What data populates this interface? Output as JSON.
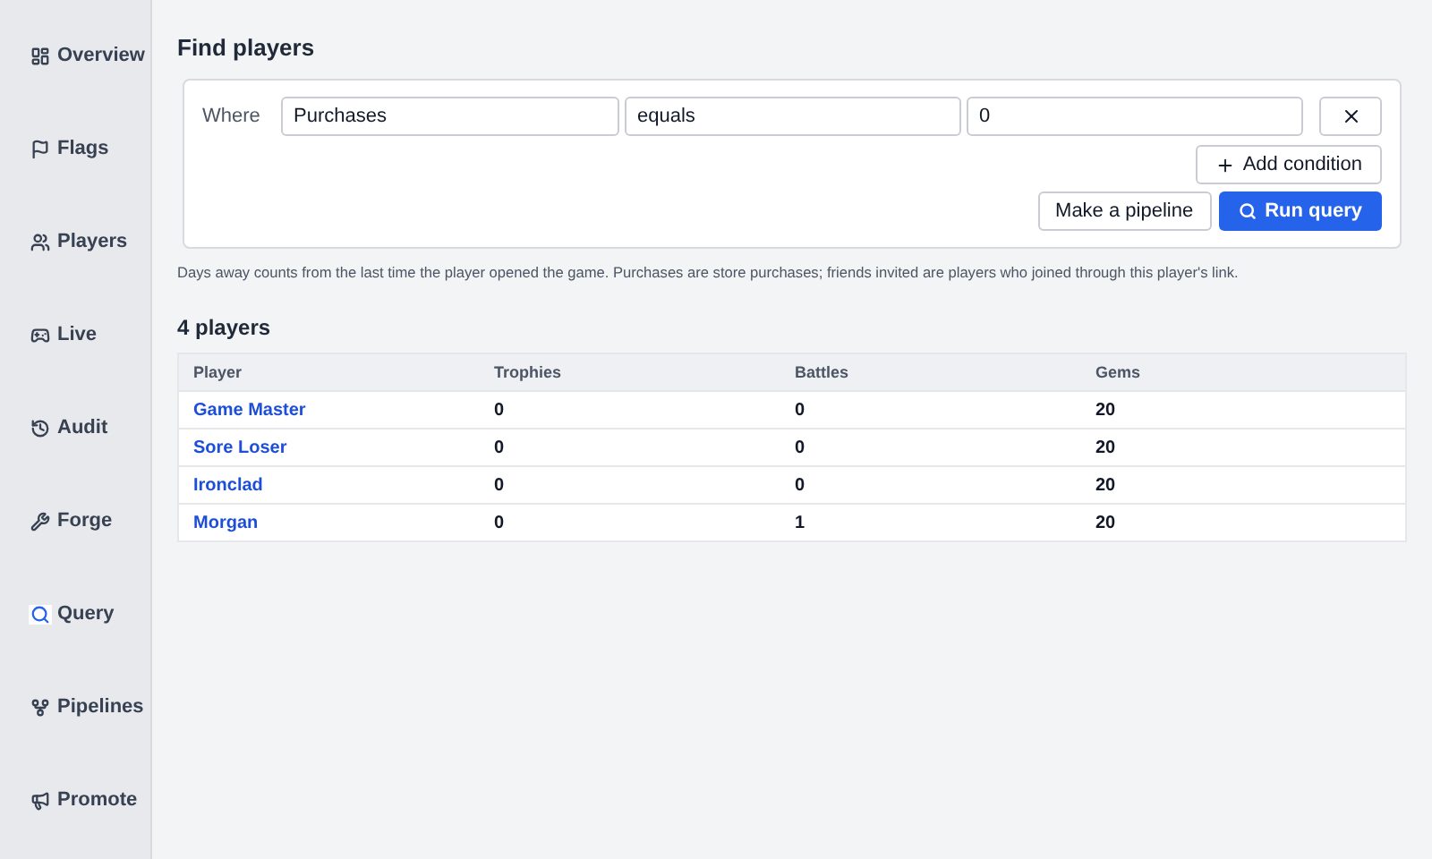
{
  "sidebar": {
    "items": [
      {
        "label": "Overview",
        "kind": "dashboard",
        "selected": false
      },
      {
        "label": "Flags",
        "kind": "flag",
        "selected": false
      },
      {
        "label": "Players",
        "kind": "users",
        "selected": false
      },
      {
        "label": "Live",
        "kind": "gamepad",
        "selected": false
      },
      {
        "label": "Audit",
        "kind": "history",
        "selected": false
      },
      {
        "label": "Forge",
        "kind": "wrench",
        "selected": false
      },
      {
        "label": "Query",
        "kind": "search",
        "selected": true
      },
      {
        "label": "Pipelines",
        "kind": "fork",
        "selected": false
      },
      {
        "label": "Promote",
        "kind": "megaphone",
        "selected": false
      }
    ]
  },
  "title": "Find players",
  "condition": {
    "label": "Where",
    "field": "Purchases",
    "operator": "equals",
    "value": "0"
  },
  "buttons": {
    "add": "Add condition",
    "pipeline": "Make a pipeline",
    "run": "Run query"
  },
  "note": "Days away counts from the last time the player opened the game. Purchases are store purchases; friends invited are players who joined through this player's link.",
  "results": {
    "title": "4 players",
    "columns": [
      "Player",
      "Trophies",
      "Battles",
      "Gems"
    ],
    "rows": [
      [
        "Game Master",
        "0",
        "0",
        "20"
      ],
      [
        "Sore Loser",
        "0",
        "0",
        "20"
      ],
      [
        "Ironclad",
        "0",
        "0",
        "20"
      ],
      [
        "Morgan",
        "0",
        "1",
        "20"
      ]
    ]
  }
}
